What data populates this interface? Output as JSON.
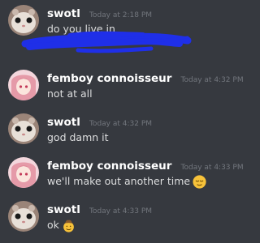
{
  "messages": [
    {
      "username": "swotl",
      "timestamp": "Today at 2:18 PM",
      "content": "do you live in",
      "avatar_icon": "hamster-avatar-icon"
    },
    {
      "username": "femboy connoisseur",
      "timestamp": "Today at 4:32 PM",
      "content": "not at all",
      "avatar_icon": "anime-girl-avatar-icon"
    },
    {
      "username": "swotl",
      "timestamp": "Today at 4:32 PM",
      "content": "god damn it",
      "avatar_icon": "hamster-avatar-icon"
    },
    {
      "username": "femboy connoisseur",
      "timestamp": "Today at 4:33 PM",
      "content": "we'll make out another time",
      "avatar_icon": "anime-girl-avatar-icon",
      "emoji": "relieved-face-emoji-icon"
    },
    {
      "username": "swotl",
      "timestamp": "Today at 4:33 PM",
      "content": "ok",
      "avatar_icon": "hamster-avatar-icon",
      "emoji": "cowboy-face-emoji-icon"
    }
  ],
  "colors": {
    "background": "#36393f",
    "username": "#ffffff",
    "timestamp": "#72767d",
    "message_text": "#dcddde",
    "redaction_scribble": "#1f2fe8"
  }
}
